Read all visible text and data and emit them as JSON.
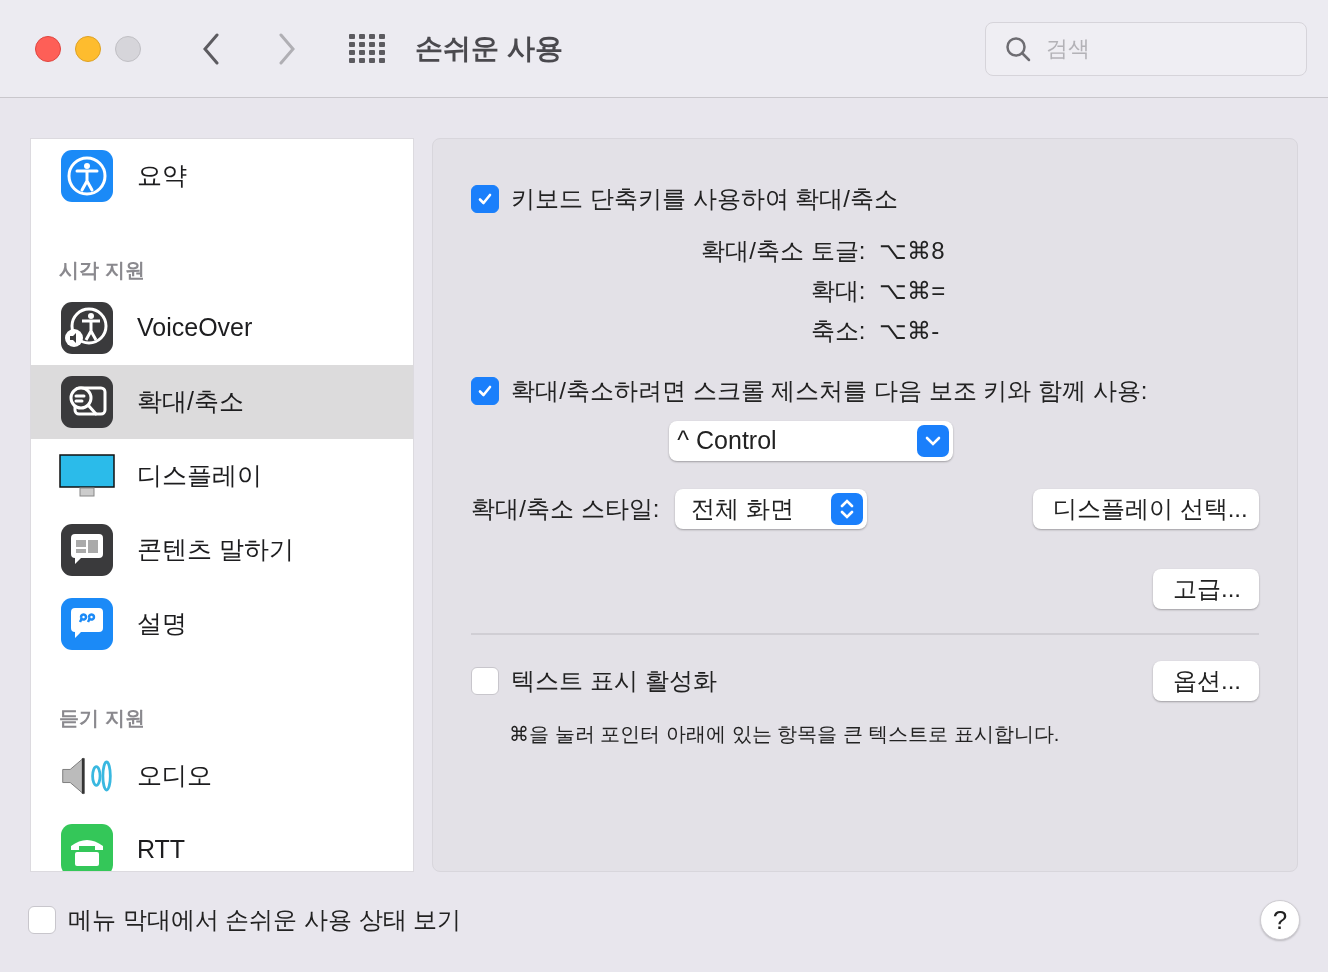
{
  "window": {
    "title": "손쉬운 사용",
    "search": {
      "placeholder": "검색"
    }
  },
  "sidebar": {
    "items": [
      {
        "kind": "item",
        "label": "요약",
        "selected": false
      },
      {
        "kind": "heading",
        "label": "시각 지원"
      },
      {
        "kind": "item",
        "label": "VoiceOver",
        "selected": false
      },
      {
        "kind": "item",
        "label": "확대/축소",
        "selected": true
      },
      {
        "kind": "item",
        "label": "디스플레이",
        "selected": false
      },
      {
        "kind": "item",
        "label": "콘텐츠 말하기",
        "selected": false
      },
      {
        "kind": "item",
        "label": "설명",
        "selected": false
      },
      {
        "kind": "heading",
        "label": "듣기 지원"
      },
      {
        "kind": "item",
        "label": "오디오",
        "selected": false
      },
      {
        "kind": "item",
        "label": "RTT",
        "selected": false
      }
    ]
  },
  "zoom": {
    "keyboard_shortcuts": {
      "label": "키보드 단축키를 사용하여 확대/축소",
      "checked": true
    },
    "shortcuts": [
      {
        "label": "확대/축소 토글:",
        "keys": "⌥⌘8"
      },
      {
        "label": "확대:",
        "keys": "⌥⌘="
      },
      {
        "label": "축소:",
        "keys": "⌥⌘-"
      }
    ],
    "scroll_gesture": {
      "label": "확대/축소하려면 스크롤 제스처를 다음 보조 키와 함께 사용:",
      "checked": true
    },
    "modifier": {
      "value": "^ Control"
    },
    "style": {
      "label": "확대/축소 스타일:",
      "value": "전체 화면"
    },
    "buttons": [
      "디스플레이 선택...",
      "고급...",
      "옵션..."
    ],
    "hover_text": {
      "label": "텍스트 표시 활성화",
      "checked": false,
      "description": "⌘을 눌러 포인터 아래에 있는 항목을 큰 텍스트로 표시합니다."
    }
  },
  "footer": {
    "menu_bar_status": {
      "label": "메뉴 막대에서 손쉬운 사용 상태 보기",
      "checked": false
    },
    "help": "?"
  }
}
